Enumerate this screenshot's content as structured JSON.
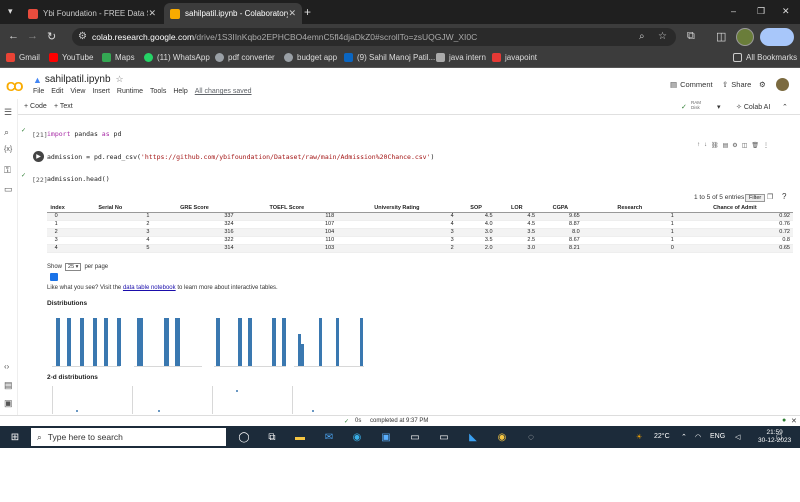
{
  "browser": {
    "tabs": [
      {
        "title": "Ybi Foundation - FREE Data Sci",
        "icon": "ybi-icon",
        "active": false
      },
      {
        "title": "sahilpatil.ipynb - Colaboratory",
        "icon": "colab-icon",
        "active": true
      }
    ],
    "new_tab": "+",
    "window_controls": {
      "minimize": "–",
      "restore": "❐",
      "close": "✕"
    },
    "url_site": "colab.research.google.com",
    "url_path": "/drive/1S3IInKqbo2EPHCBO4emnC5fl4djaDkZ0#scrollTo=zsUQGJW_XI0C",
    "bookmarks": [
      {
        "label": "Gmail",
        "icon": "gmail-icon",
        "color": "#ea4335"
      },
      {
        "label": "YouTube",
        "icon": "youtube-icon",
        "color": "#ff0000"
      },
      {
        "label": "Maps",
        "icon": "maps-icon",
        "color": "#34a853"
      },
      {
        "label": "(11) WhatsApp",
        "icon": "whatsapp-icon",
        "color": "#25d366"
      },
      {
        "label": "pdf converter",
        "icon": "globe-icon",
        "color": "#9aa0a6"
      },
      {
        "label": "budget app",
        "icon": "globe-icon",
        "color": "#9aa0a6"
      },
      {
        "label": "(9) Sahil Manoj Patil...",
        "icon": "linkedin-icon",
        "color": "#0a66c2"
      },
      {
        "label": "java intern",
        "icon": "folder-icon",
        "color": "#aaaaaa"
      },
      {
        "label": "javapoint",
        "icon": "javapoint-icon",
        "color": "#e53935"
      }
    ],
    "all_bookmarks": "All Bookmarks"
  },
  "colab": {
    "notebook_name": "sahilpatil.ipynb",
    "menus": [
      "File",
      "Edit",
      "View",
      "Insert",
      "Runtime",
      "Tools",
      "Help"
    ],
    "saved_status": "All changes saved",
    "comment": "Comment",
    "share": "Share",
    "add_code": "+ Code",
    "add_text": "+ Text",
    "ram_label": "RAM",
    "disk_label": "Disk",
    "colab_ai": "Colab AI"
  },
  "cells": [
    {
      "exec": "[21]",
      "code_kw": "import",
      "code_rest_a": " pandas ",
      "code_kw2": "as",
      "code_rest_b": " pd"
    },
    {
      "exec": "",
      "code_prefix": "admission = pd.read_csv(",
      "code_str": "'https://github.com/ybifoundation/Dataset/raw/main/Admission%20Chance.csv'",
      "code_suffix": ")"
    },
    {
      "exec": "[22]",
      "code": "admission.head()"
    }
  ],
  "table": {
    "info": "1 to 5 of 5 entries",
    "filter": "Filter",
    "columns": [
      "index",
      "Serial No",
      "GRE Score",
      "TOEFL Score",
      "University Rating",
      "SOP",
      "LOR",
      "CGPA",
      "Research",
      "Chance of Admit"
    ],
    "rows": [
      [
        "0",
        "1",
        "337",
        "118",
        "4",
        "4.5",
        "4.5",
        "9.65",
        "1",
        "0.92"
      ],
      [
        "1",
        "2",
        "324",
        "107",
        "4",
        "4.0",
        "4.5",
        "8.87",
        "1",
        "0.76"
      ],
      [
        "2",
        "3",
        "316",
        "104",
        "3",
        "3.0",
        "3.5",
        "8.0",
        "1",
        "0.72"
      ],
      [
        "3",
        "4",
        "322",
        "110",
        "3",
        "3.5",
        "2.5",
        "8.67",
        "1",
        "0.8"
      ],
      [
        "4",
        "5",
        "314",
        "103",
        "2",
        "2.0",
        "3.0",
        "8.21",
        "0",
        "0.65"
      ]
    ],
    "show_prefix": "Show",
    "page_size": "25",
    "show_suffix": "per page"
  },
  "promo": {
    "before": "Like what you see? Visit the ",
    "link": "data table notebook",
    "after": " to learn more about interactive tables."
  },
  "sections": {
    "distributions": "Distributions",
    "distributions_2d": "2-d distributions"
  },
  "status": {
    "check": "✓",
    "time": "0s",
    "completed": "completed at 9:37 PM"
  },
  "taskbar": {
    "search_placeholder": "Type here to search",
    "weather": "22°C",
    "lang": "ENG",
    "time": "21:59",
    "date": "30-12-2023"
  },
  "colors": {
    "accent": "#1a73e8",
    "bar": "#3a78b0",
    "colab_orange": "#f9ab00"
  }
}
